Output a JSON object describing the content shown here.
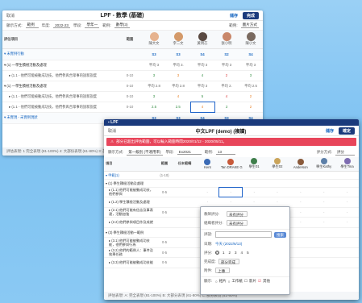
{
  "back_window": {
    "back_label": "取消",
    "title": "LPF - 數學 (基礎)",
    "save_label": "儲存",
    "done_label": "完成",
    "filters": [
      {
        "label": "顯示方式:",
        "value": "範例"
      },
      {
        "label": "年度:",
        "value": "2022-23"
      },
      {
        "label": "學段:",
        "value": "學年一"
      },
      {
        "label": "範例:",
        "value": "數學(3)"
      }
    ],
    "filter_right": {
      "label": "範例:",
      "value": "圖片方式"
    },
    "col_header": "評估項目",
    "col_range": "範圍",
    "students": [
      "陳大文",
      "李二文",
      "黃明芯",
      "張小明",
      "陳小文"
    ],
    "rows": [
      {
        "type": "group",
        "label": "▾ 未實例行動",
        "cells": [
          "S3",
          "S3",
          "S4",
          "S2",
          "S4"
        ],
        "styles": [
          "lvl",
          "lvl",
          "lvl",
          "lvl",
          "lvl"
        ]
      },
      {
        "type": "item",
        "label": "▾ (1) 一學生積極活動及處理",
        "range": "",
        "cells": [
          "平均 3",
          "平均 3.",
          "平均 3",
          "平均 3",
          "平均 3"
        ],
        "styles": [
          "c-avg",
          "c-avg",
          "c-avg",
          "c-avg",
          "c-avg"
        ]
      },
      {
        "type": "sub",
        "label": "▸ (1.1 - 他們可能被動成功技，他們參與合眾事的說新說度",
        "range": "0-10",
        "cells": [
          "3",
          "3",
          "4",
          "2",
          "3"
        ],
        "styles": [
          "c-g",
          "c-o",
          "c-g",
          "c-r",
          "c-g"
        ]
      },
      {
        "type": "item",
        "label": "▾ (1) 一學生積極活動及處理",
        "range": "0-10",
        "cells": [
          "平均 2.8",
          "平均 2.8",
          "平均 3",
          "平均 2.",
          "平均 2.5"
        ],
        "styles": [
          "c-avg",
          "c-avg",
          "c-avg",
          "c-avg",
          "c-avg"
        ]
      },
      {
        "type": "sub",
        "label": "▸ (1.1 - 他們可能被動成功技，他們參與合眾事的說新說度",
        "range": "0-10",
        "cells": [
          "3",
          "4",
          "5",
          "4",
          "2"
        ],
        "styles": [
          "c-g",
          "c-o",
          "c-g",
          "c-r",
          "c-o"
        ]
      },
      {
        "type": "sub",
        "label": "▸ (1.1 - 他們可能被動成功技，他們參與合眾事的說新說度",
        "range": "0-10",
        "cells": [
          "2.5",
          "2.5",
          "4",
          "2",
          "2"
        ],
        "styles": [
          "c-g",
          "c-g",
          "c-o",
          "c-g",
          "c-o"
        ]
      },
      {
        "type": "group",
        "label": "▾ 未實現 - 未實例現狀",
        "cells": [
          "S3",
          "S3",
          "S4",
          "S3",
          "S4"
        ],
        "styles": [
          "lvl",
          "lvl",
          "lvl",
          "lvl",
          "lvl"
        ]
      }
    ],
    "footer": "評估表現: 1 完全表現 (81-100%)  4: 大部份表現 (61-80%)  3: 部份表現"
  },
  "front_window": {
    "back_label": "取消",
    "title": "中文LPF (demo) (複讀)",
    "save_label": "儲存",
    "done_label": "確定",
    "alert": "部分已超出評估範圍，可以輸入範圍時間2020/01/12 - 2020/05/11。",
    "filters": [
      {
        "label": "顯示方式:",
        "value": "第一級別 (不適用率)"
      },
      {
        "label": "學段:",
        "value": "Ex2021"
      },
      {
        "label": "範例:",
        "value": "13"
      },
      {
        "label": "評分方式:",
        "value": "評分"
      }
    ],
    "col_header": "項目",
    "col_range": "範圍",
    "col_teacher": "任本範疇",
    "students": [
      "Kent",
      "Tan DRAKE GIN",
      "學生01",
      "學生02",
      "Anderson",
      "學生Kathy",
      "學生Tina"
    ],
    "rows": [
      {
        "label": "▾ 甲範(1)",
        "range": "(1-10)"
      },
      {
        "label": "▾ (1) 學生積極活動及處理",
        "range": ""
      },
      {
        "label": "▸ (1.1) 他們可能被動成功技，他們參與",
        "range": "0-5"
      },
      {
        "label": "▸ (1.2) 學生積極活動及處理",
        "range": ""
      },
      {
        "label": "▸ (2.1) 他們可能有信念及事表達，活動加強",
        "range": "0-5"
      },
      {
        "label": "▸ (2.2) 他們參與項目作及成就",
        "range": ""
      },
      {
        "label": "▾ (3) 學生積極活動一範例",
        "range": ""
      },
      {
        "label": "▸ (3.1) 他們可能被動成功技能，他們參與行為",
        "range": "0-5"
      },
      {
        "label": "▸ (3.2) 他們的範例人：事件及效果任務",
        "range": "0-5"
      },
      {
        "label": "▸ (3.3) 他們可能被動成功技能",
        "range": "0-5"
      }
    ],
    "footer": "評估表現: A: 完全表現 (81-100%)  B: 大部分表現 (61-80%)  C: 部分表現 (41-60%)",
    "popup": {
      "rater_label": "教師評分:",
      "rater_value": "未有評分",
      "peer_label": "組織者評分:",
      "peer_value": "未有評分",
      "comment_label": "評語:",
      "comment_button": "搜索",
      "date_label": "日期:",
      "date_value": "今天 (2022/6/13)",
      "score_label": "評分:",
      "scores": [
        "0",
        "1",
        "2",
        "3",
        "4",
        "5"
      ],
      "level_label": "完成度:",
      "level_value": "部分完成",
      "attach_label": "附件:",
      "attach_value": "上傳",
      "visibility_label": "顯示:",
      "options": [
        "相片",
        "工作紙",
        "影片",
        "其他"
      ]
    }
  }
}
